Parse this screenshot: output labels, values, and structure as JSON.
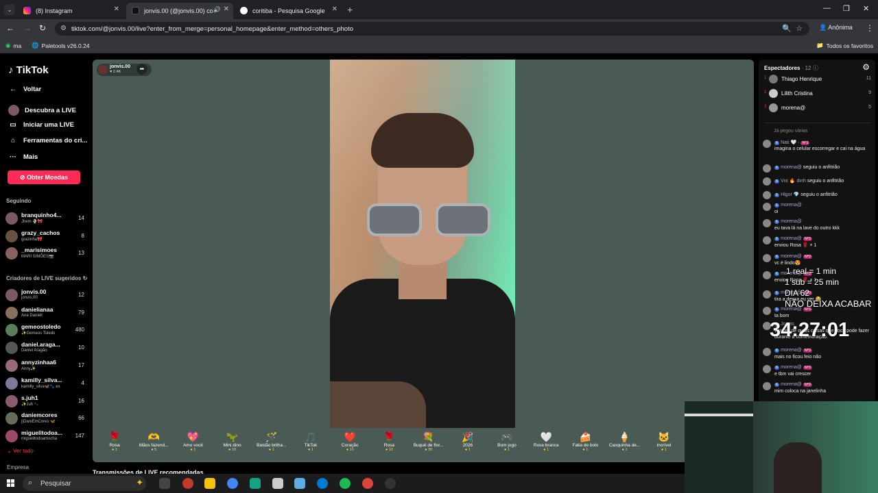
{
  "browser": {
    "tabs": [
      {
        "title": "(8) Instagram",
        "color": "#e1306c"
      },
      {
        "title": "jonvis.00 (@jonvis.00) com",
        "color": "#111111"
      },
      {
        "title": "coritiba - Pesquisa Google",
        "color": "#4285f4"
      }
    ],
    "url": "tiktok.com/@jonvis.00/live?enter_from_merge=personal_homepage&enter_method=others_photo",
    "incognito_label": "Anônima",
    "bookmarks": [
      "ma",
      "Paletools v26.0.24"
    ],
    "all_favorites": "Todos os favoritos"
  },
  "sidebar": {
    "logo": "TikTok",
    "back": "Voltar",
    "nav": [
      {
        "label": "Descubra a LIVE",
        "icon": "live-discover-icon"
      },
      {
        "label": "Iniciar uma LIVE",
        "icon": "video-camera-icon"
      },
      {
        "label": "Ferramentas do cri...",
        "icon": "home-tools-icon"
      },
      {
        "label": "Mais",
        "icon": "more-dots-icon"
      }
    ],
    "coins_button": "Obter Moedas",
    "following_title": "Seguindo",
    "following": [
      {
        "name": "branquinho4...",
        "sub": "Jhem 🍨🎀",
        "count": "14"
      },
      {
        "name": "grazy_cachos",
        "sub": "grazinha🎀",
        "count": "8"
      },
      {
        "name": "_marisimoes",
        "sub": "MARI SIMÕES📷",
        "count": "13"
      }
    ],
    "suggested_title": "Criadores de LIVE sugeridos",
    "suggested": [
      {
        "name": "jonvis.00",
        "sub": "jonvis.00",
        "count": "12"
      },
      {
        "name": "danielianaa",
        "sub": "Ana Daniell",
        "count": "79"
      },
      {
        "name": "gemeostoledo",
        "sub": "✨Gemeos Toledo",
        "count": "480"
      },
      {
        "name": "daniel.araga...",
        "sub": "Daniel Aragão",
        "count": "10"
      },
      {
        "name": "annyzinhaa6",
        "sub": "Anny✨",
        "count": "17"
      },
      {
        "name": "kamilly_silva...",
        "sub": "kamilly_silva🦋🐾 ex",
        "count": "4"
      },
      {
        "name": "s.juh1",
        "sub": "✨Juh ⁺₊",
        "count": "16"
      },
      {
        "name": "daniemcores",
        "sub": "||DaniEmCores 🦋",
        "count": "66"
      },
      {
        "name": "miguelitodoa...",
        "sub": "miguelitodoamocha",
        "count": "147"
      }
    ],
    "see_all": "Ver tudo",
    "company": "Empresa"
  },
  "stream": {
    "streamer": "jonvis.00",
    "likes": "2.4K",
    "gifts": [
      {
        "name": "Rosa",
        "price": "1",
        "icon": "🌹"
      },
      {
        "name": "Mãos fazend...",
        "price": "5",
        "icon": "🫶"
      },
      {
        "name": "Amo você",
        "price": "1",
        "icon": "💖"
      },
      {
        "name": "Mini dino",
        "price": "10",
        "icon": "🦖"
      },
      {
        "name": "Bastão brilha...",
        "price": "1",
        "icon": "🪄"
      },
      {
        "name": "TikTok",
        "price": "1",
        "icon": "🎵"
      },
      {
        "name": "Coração",
        "price": "10",
        "icon": "❤️"
      },
      {
        "name": "Rosa",
        "price": "10",
        "icon": "🌹"
      },
      {
        "name": "Buquê de flor...",
        "price": "30",
        "icon": "💐"
      },
      {
        "name": "2026",
        "price": "1",
        "icon": "🎉"
      },
      {
        "name": "Bom jogo",
        "price": "1",
        "icon": "🎮"
      },
      {
        "name": "Rosa branca",
        "price": "1",
        "icon": "🤍"
      },
      {
        "name": "Fatia de bolo",
        "price": "1",
        "icon": "🍰"
      },
      {
        "name": "Casquinha de...",
        "price": "1",
        "icon": "🍦"
      },
      {
        "name": "Incrível",
        "price": "1",
        "icon": "🐱"
      }
    ],
    "recommended": "Transmissões de LIVE recomendadas"
  },
  "panel": {
    "viewers_title": "Espectadores",
    "viewers_count": "12",
    "viewers": [
      {
        "rank": "1",
        "name": "Thiago Henrique",
        "score": "11"
      },
      {
        "rank": "2",
        "name": "Lilith Cristina",
        "score": "9"
      },
      {
        "rank": "3",
        "name": "morena@",
        "score": "5"
      }
    ],
    "system_note": "Já pegou várias",
    "chat": [
      {
        "user": "Nati 🤍 ·",
        "badge": "Nº3",
        "text": "imagina o celular escorregar e cai na água"
      },
      {
        "user": "morena@",
        "inline": "seguiu o anfitrião"
      },
      {
        "user": "Vıα 🔥 dınh",
        "inline": "seguiu o anfitrião"
      },
      {
        "user": "Higor 💎",
        "inline": "seguiu o anfitrião"
      },
      {
        "user": "morena@",
        "text": "oi"
      },
      {
        "user": "morena@",
        "text": "eu tava lá na lave do outro kkk"
      },
      {
        "user": "morena@",
        "badge": "Nº3",
        "text": "enviou Rosa 🌹 × 1"
      },
      {
        "user": "morena@",
        "badge": "Nº3",
        "text": "vc é lindo😍"
      },
      {
        "user": "morena@",
        "badge": "Nº3",
        "text": "enviou Rosa 🌹 × 1"
      },
      {
        "user": "morena@",
        "badge": "Nº3",
        "text": "tira a dessa eu ver 😂"
      },
      {
        "user": "morena@",
        "badge": "Nº3",
        "text": "ta bom"
      },
      {
        "user": "Jonvis",
        "text": "venceu de quais coisas que você pode fazer durante a comemoração."
      },
      {
        "user": "morena@",
        "badge": "Nº3",
        "text": "mais no ficou feio não"
      },
      {
        "user": "morena@",
        "badge": "Nº3",
        "text": "e tbm vai crescer"
      },
      {
        "user": "morena@",
        "badge": "Nº3",
        "text": "mim coloca na janelinha"
      }
    ]
  },
  "overlay": {
    "line1": "1 real = 1 min",
    "line2": "1 sub = 25 min",
    "line3": "DIA 62",
    "line4": "NÃO DEIXA ACABAR",
    "timer": "34:27:01"
  },
  "taskbar": {
    "search_placeholder": "Pesquisar"
  }
}
